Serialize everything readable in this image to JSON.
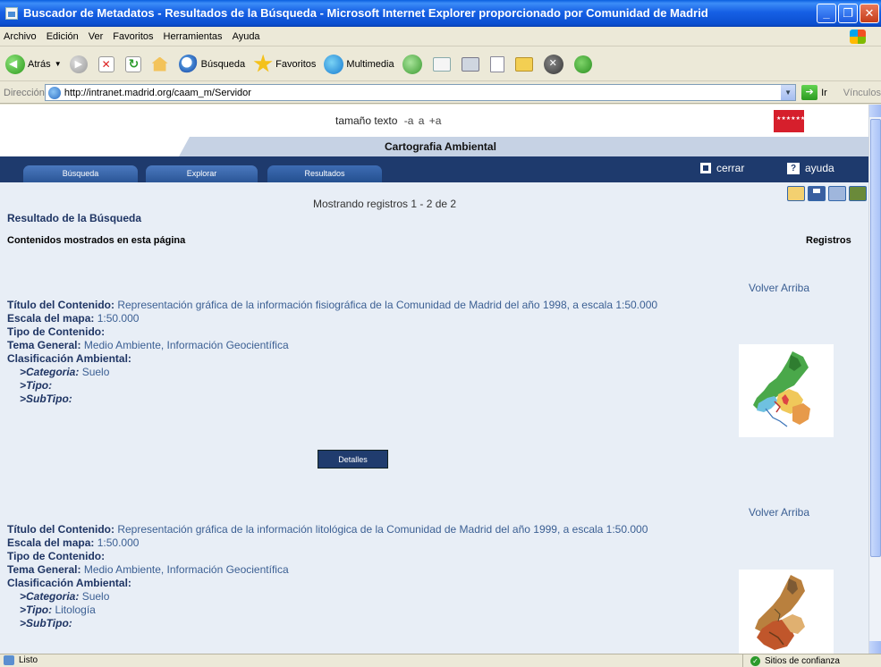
{
  "window": {
    "title": "Buscador de Metadatos - Resultados de la Búsqueda - Microsoft Internet Explorer proporcionado por Comunidad de Madrid",
    "minimize_glyph": "_",
    "maximize_glyph": "❐",
    "close_glyph": "✕"
  },
  "menu": [
    "Archivo",
    "Edición",
    "Ver",
    "Favoritos",
    "Herramientas",
    "Ayuda"
  ],
  "toolbar": {
    "back_label": "Atrás",
    "search_label": "Búsqueda",
    "favorites_label": "Favoritos",
    "media_label": "Multimedia"
  },
  "address": {
    "label": "Dirección",
    "url": "http://intranet.madrid.org/caam_m/Servidor",
    "go_label": "Ir",
    "links_label": "Vínculos"
  },
  "page": {
    "text_size_label": "tamaño texto",
    "size_options": [
      "-a",
      "a",
      "+a"
    ],
    "section_title": "Cartografia Ambiental",
    "nav_tabs": [
      "Búsqueda",
      "Explorar",
      "Resultados"
    ],
    "close_label": "cerrar",
    "help_label": "ayuda",
    "help_glyph": "?",
    "showing_text": "Mostrando registros 1 - 2 de 2",
    "results_title": "Resultado de la Búsqueda",
    "contents_label": "Contenidos mostrados en esta página",
    "records_label": "Registros",
    "back_to_top": "Volver Arriba",
    "details_label": "Detalles"
  },
  "labels": {
    "title": "Título del Contenido:",
    "scale": "Escala del mapa:",
    "type": "Tipo de Contenido:",
    "theme": "Tema General:",
    "classification": "Clasificación Ambiental:",
    "category": ">Categoria:",
    "subtype_type": ">Tipo:",
    "subtype": ">SubTipo:"
  },
  "records": [
    {
      "title": "Representación gráfica de la información fisiográfica de la Comunidad de Madrid del año 1998, a escala 1:50.000",
      "scale": "1:50.000",
      "content_type": "",
      "theme": "Medio Ambiente, Información Geocientífica",
      "category": "Suelo",
      "type": "",
      "subtype": ""
    },
    {
      "title": "Representación gráfica de la información litológica de la Comunidad de Madrid del año 1999, a escala 1:50.000",
      "scale": "1:50.000",
      "content_type": "",
      "theme": "Medio Ambiente, Información Geocientífica",
      "category": "Suelo",
      "type": "Litología",
      "subtype": ""
    }
  ],
  "status": {
    "left": "Listo",
    "zone": "Sitios de confianza"
  },
  "colors": {
    "titlebar": "#0b4fd0",
    "nav_bg": "#1e3a6d",
    "page_bg": "#e8eef6",
    "link_text": "#3b5f93",
    "label_text": "#1f3564"
  }
}
